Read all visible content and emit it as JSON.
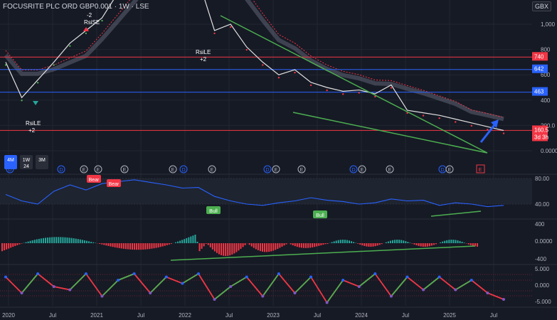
{
  "header": {
    "title": "FOCUSRITE PLC ORD GBP0.001 · 1W · LSE",
    "currency": "GBX"
  },
  "colors": {
    "bg": "#161a25",
    "grid": "#222631",
    "red": "#f23645",
    "blue": "#2962ff",
    "green": "#4caf50",
    "teal": "#26a69a",
    "price": "#e0e0e0",
    "rsi": "#2962ff"
  },
  "timeframe_buttons": [
    "4M",
    "1W\n24",
    "3M"
  ],
  "chart_data": [
    {
      "type": "line",
      "name": "price",
      "x": [
        "2020-01",
        "2020-03",
        "2020-05",
        "2020-07",
        "2020-09",
        "2020-11",
        "2021-01",
        "2021-03",
        "2021-05",
        "2021-07",
        "2021-09",
        "2021-11",
        "2022-01",
        "2022-03",
        "2022-05",
        "2022-07",
        "2022-09",
        "2022-11",
        "2023-01",
        "2023-03",
        "2023-05",
        "2023-07",
        "2023-09",
        "2023-11",
        "2024-01",
        "2024-03",
        "2024-05",
        "2024-07",
        "2024-09",
        "2024-11",
        "2025-01",
        "2025-03"
      ],
      "y": [
        700,
        420,
        560,
        700,
        850,
        950,
        1050,
        1250,
        1400,
        1600,
        1750,
        1500,
        1350,
        950,
        1000,
        820,
        700,
        600,
        640,
        540,
        500,
        470,
        480,
        450,
        520,
        320,
        300,
        280,
        250,
        220,
        190,
        160
      ],
      "ylabels": [
        "1,000",
        "800",
        "600",
        "400",
        "200.0",
        "0.0000"
      ],
      "yticks": [
        1000,
        800,
        600,
        400,
        200,
        0
      ],
      "x_tick_labels": [
        "2020",
        "Jul",
        "2021",
        "Jul",
        "2022",
        "Jul",
        "2023",
        "Jul",
        "2024",
        "Jul",
        "2025",
        "Jul"
      ],
      "hlines": [
        {
          "value": 740,
          "label": "740",
          "color": "#f23645"
        },
        {
          "value": 642,
          "label": "642",
          "color": "#2962ff"
        },
        {
          "value": 463,
          "label": "463",
          "color": "#2962ff"
        },
        {
          "value": 160.5,
          "label": "160.5\n3d 3h",
          "color": "#f23645"
        }
      ],
      "annotations": [
        "RsiSE",
        "-2",
        "RsiLE",
        "+2",
        "RsiLE",
        "+2"
      ]
    },
    {
      "type": "line",
      "name": "rsi",
      "yticks_labels": [
        "80.00",
        "40.00"
      ],
      "y": [
        55,
        45,
        40,
        60,
        70,
        62,
        72,
        75,
        78,
        74,
        70,
        65,
        66,
        52,
        45,
        40,
        38,
        42,
        45,
        50,
        46,
        44,
        40,
        42,
        48,
        45,
        46,
        38,
        42,
        40,
        36,
        38
      ],
      "labels": [
        "Bear",
        "Bear",
        "Bull",
        "Bull"
      ]
    },
    {
      "type": "bar",
      "name": "macd",
      "yticks_labels": [
        "400",
        "0.0000",
        "-400"
      ]
    },
    {
      "type": "line",
      "name": "oscillator",
      "yticks_labels": [
        "5.000",
        "0.000",
        "-5.000"
      ]
    }
  ],
  "event_markers": [
    "D",
    "D",
    "E",
    "E",
    "E",
    "E",
    "D",
    "E",
    "D",
    "E",
    "E",
    "D",
    "E",
    "E",
    "D",
    "E"
  ]
}
